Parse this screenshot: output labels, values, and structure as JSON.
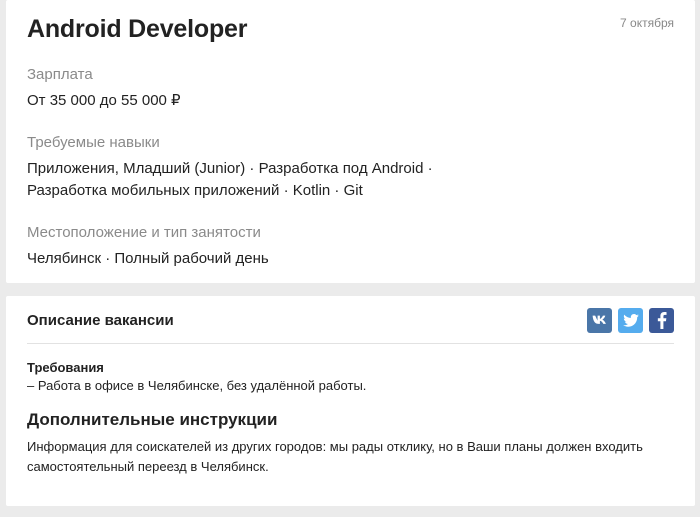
{
  "vacancy": {
    "title": "Android Developer",
    "date": "7 октября",
    "salary_label": "Зарплата",
    "salary_value": "От 35 000 до 55 000 ₽",
    "skills_label": "Требуемые навыки",
    "skills_line1": "Приложения, Младший (Junior) · Разработка под Android ·",
    "skills_line2": "Разработка мобильных приложений · Kotlin · Git",
    "location_label": "Местоположение и тип занятости",
    "location_value": "Челябинск · Полный рабочий день"
  },
  "description": {
    "title": "Описание вакансии",
    "share": {
      "icons": [
        "vk-icon",
        "twitter-icon",
        "facebook-icon"
      ],
      "colors": {
        "vk": "#4a76a8",
        "twitter": "#55acee",
        "facebook": "#3b5998"
      }
    },
    "requirements_title": "Требования",
    "requirements_item": "– Работа в офисе в Челябинске, без удалённой работы.",
    "instructions_title": "Дополнительные инструкции",
    "instructions_text": "Информация для соискателей из других городов: мы рады отклику, но в Ваши планы должен входить самостоятельный переезд в Челябинск."
  }
}
